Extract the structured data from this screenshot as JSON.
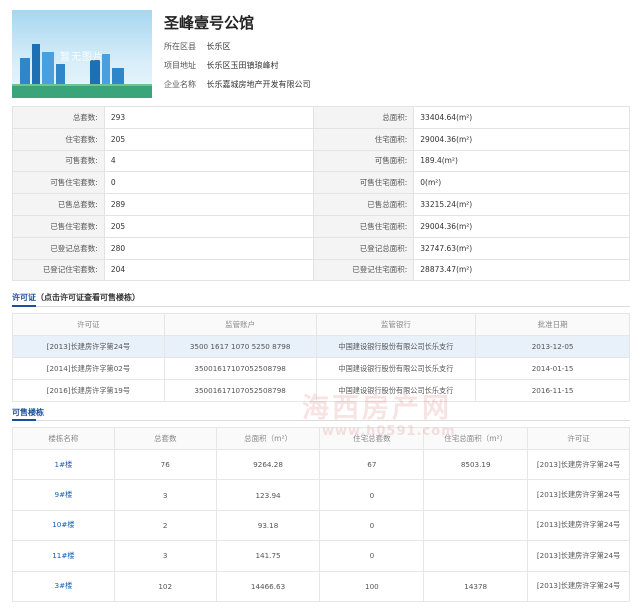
{
  "project": {
    "title": "圣峰壹号公馆",
    "image_watermark": "暂无图片",
    "info": [
      {
        "key": "所在区县",
        "value": "长乐区"
      },
      {
        "key": "项目地址",
        "value": "长乐区玉田镇琅峰村"
      },
      {
        "key": "企业名称",
        "value": "长乐嘉城房地产开发有限公司"
      }
    ]
  },
  "stats": [
    {
      "l1": "总套数:",
      "v1": "293",
      "l2": "总面积:",
      "v2": "33404.64(m²)"
    },
    {
      "l1": "住宅套数:",
      "v1": "205",
      "l2": "住宅面积:",
      "v2": "29004.36(m²)"
    },
    {
      "l1": "可售套数:",
      "v1": "4",
      "l2": "可售面积:",
      "v2": "189.4(m²)"
    },
    {
      "l1": "可售住宅套数:",
      "v1": "0",
      "l2": "可售住宅面积:",
      "v2": "0(m²)"
    },
    {
      "l1": "已售总套数:",
      "v1": "289",
      "l2": "已售总面积:",
      "v2": "33215.24(m²)"
    },
    {
      "l1": "已售住宅套数:",
      "v1": "205",
      "l2": "已售住宅面积:",
      "v2": "29004.36(m²)"
    },
    {
      "l1": "已登记总套数:",
      "v1": "280",
      "l2": "已登记总面积:",
      "v2": "32747.63(m²)"
    },
    {
      "l1": "已登记住宅套数:",
      "v1": "204",
      "l2": "已登记住宅面积:",
      "v2": "28873.47(m²)"
    }
  ],
  "permit_section": {
    "title": "许可证",
    "subtitle": "（点击许可证查看可售楼栋）",
    "headers": [
      "许可证",
      "监管账户",
      "监管银行",
      "批准日期"
    ],
    "rows": [
      [
        "[2013]长建房许字第24号",
        "3500 1617 1070 5250 8798",
        "中国建设银行股份有限公司长乐支行",
        "2013-12-05"
      ],
      [
        "[2014]长建房许字第02号",
        "35001617107052508798",
        "中国建设银行股份有限公司长乐支行",
        "2014-01-15"
      ],
      [
        "[2016]长建房许字第19号",
        "35001617107052508798",
        "中国建设银行股份有限公司长乐支行",
        "2016-11-15"
      ]
    ]
  },
  "building_section": {
    "title": "可售楼栋",
    "headers": [
      "楼栋名称",
      "总套数",
      "总面积（m²）",
      "住宅总套数",
      "住宅总面积（m²）",
      "许可证"
    ],
    "rows": [
      [
        "1#楼",
        "76",
        "9264.28",
        "67",
        "8503.19",
        "[2013]长建房许字第24号"
      ],
      [
        "9#楼",
        "3",
        "123.94",
        "0",
        "",
        "[2013]长建房许字第24号"
      ],
      [
        "10#楼",
        "2",
        "93.18",
        "0",
        "",
        "[2013]长建房许字第24号"
      ],
      [
        "11#楼",
        "3",
        "141.75",
        "0",
        "",
        "[2013]长建房许字第24号"
      ],
      [
        "3#楼",
        "102",
        "14466.63",
        "100",
        "14378",
        "[2013]长建房许字第24号"
      ]
    ]
  },
  "watermark": {
    "line1": "海西房产网",
    "line2": "www.h0591.com"
  }
}
